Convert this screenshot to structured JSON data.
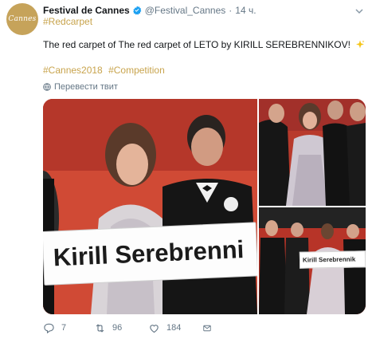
{
  "account": {
    "avatar_text": "Cannes",
    "display_name": "Festival de Cannes",
    "handle": "@Festival_Cannes",
    "separator": "·",
    "time": "14 ч."
  },
  "tweet": {
    "hashtag_line": "#Redcarpet",
    "text": "The red carpet of The red carpet of LETO by KIRILL SEREBRENNIKOV!",
    "hashtags": [
      "#Cannes2018",
      "#Competition"
    ],
    "translate_label": "Перевести твит"
  },
  "media": {
    "sign_main_text": "Kirill Serebrenni",
    "sign_small_text": "Kirill Serebrennik"
  },
  "actions": {
    "reply_count": "7",
    "retweet_count": "96",
    "like_count": "184"
  },
  "colors": {
    "hashtag": "#c8a44d",
    "verified": "#1da1f2",
    "secondary_text": "#657786",
    "carpet_red": "#c0392b",
    "avatar_gold": "#c6a35a"
  },
  "icons": [
    "verified-badge-icon",
    "chevron-down-icon",
    "sparkle-icon",
    "globe-icon",
    "reply-icon",
    "retweet-icon",
    "like-icon",
    "direct-message-icon"
  ]
}
